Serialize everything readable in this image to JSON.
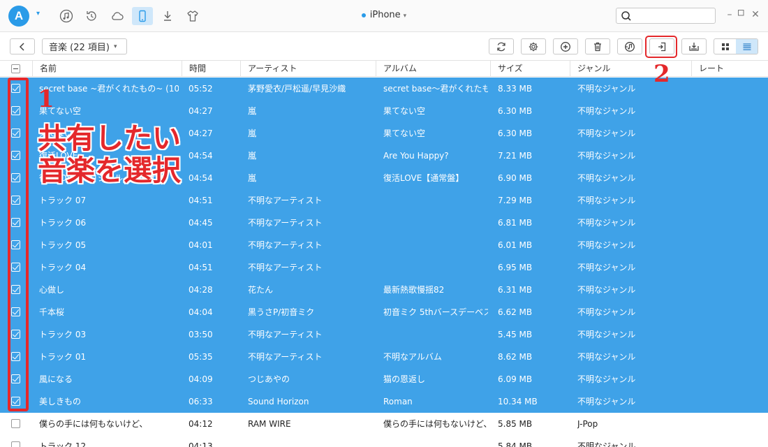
{
  "app": {
    "logo_letter": "A"
  },
  "topnav": {
    "items": [
      {
        "name": "itunes-music-icon",
        "icon": "music"
      },
      {
        "name": "backup-icon",
        "icon": "restore"
      },
      {
        "name": "icloud-icon",
        "icon": "cloud"
      },
      {
        "name": "device-icon",
        "icon": "phone",
        "active": true
      },
      {
        "name": "download-icon",
        "icon": "download"
      },
      {
        "name": "tshirt-icon",
        "icon": "shirt"
      }
    ],
    "device_name": "iPhone",
    "search_placeholder": ""
  },
  "toolbar": {
    "category_label": "音楽 (22 項目)"
  },
  "table": {
    "headers": {
      "name": "名前",
      "time": "時間",
      "artist": "アーティスト",
      "album": "アルバム",
      "size": "サイズ",
      "genre": "ジャンル",
      "rating": "レート"
    },
    "rows": [
      {
        "selected": true,
        "name": "secret base ~君がくれたもの~ (10 yea...",
        "time": "05:52",
        "artist": "茅野愛衣/戸松遥/早見沙織",
        "album": "secret base〜君がくれたも...",
        "size": "8.33 MB",
        "genre": "不明なジャンル"
      },
      {
        "selected": true,
        "name": "果てない空",
        "time": "04:27",
        "artist": "嵐",
        "album": "果てない空",
        "size": "6.30 MB",
        "genre": "不明なジャンル"
      },
      {
        "selected": true,
        "name": "果てない空",
        "time": "04:27",
        "artist": "嵐",
        "album": "果てない空",
        "size": "6.30 MB",
        "genre": "不明なジャンル"
      },
      {
        "selected": true,
        "name": "復活LOVE",
        "time": "04:54",
        "artist": "嵐",
        "album": "Are You Happy?",
        "size": "7.21 MB",
        "genre": "不明なジャンル"
      },
      {
        "selected": true,
        "name": "復活LOVE(オリジナル・カラオケ)",
        "time": "04:54",
        "artist": "嵐",
        "album": "復活LOVE【通常盤】",
        "size": "6.90 MB",
        "genre": "不明なジャンル"
      },
      {
        "selected": true,
        "name": "トラック 07",
        "time": "04:51",
        "artist": "不明なアーティスト",
        "album": "",
        "size": "7.29 MB",
        "genre": "不明なジャンル"
      },
      {
        "selected": true,
        "name": "トラック 06",
        "time": "04:45",
        "artist": "不明なアーティスト",
        "album": "",
        "size": "6.81 MB",
        "genre": "不明なジャンル"
      },
      {
        "selected": true,
        "name": "トラック 05",
        "time": "04:01",
        "artist": "不明なアーティスト",
        "album": "",
        "size": "6.01 MB",
        "genre": "不明なジャンル"
      },
      {
        "selected": true,
        "name": "トラック 04",
        "time": "04:51",
        "artist": "不明なアーティスト",
        "album": "",
        "size": "6.95 MB",
        "genre": "不明なジャンル"
      },
      {
        "selected": true,
        "name": "心做し",
        "time": "04:28",
        "artist": "花たん",
        "album": "最新熱歌慢揺82",
        "size": "6.31 MB",
        "genre": "不明なジャンル"
      },
      {
        "selected": true,
        "name": "千本桜",
        "time": "04:04",
        "artist": "黒うさP/初音ミク",
        "album": "初音ミク 5thバースデーベスト...",
        "size": "6.62 MB",
        "genre": "不明なジャンル"
      },
      {
        "selected": true,
        "name": "トラック 03",
        "time": "03:50",
        "artist": "不明なアーティスト",
        "album": "",
        "size": "5.45 MB",
        "genre": "不明なジャンル"
      },
      {
        "selected": true,
        "name": "トラック 01",
        "time": "05:35",
        "artist": "不明なアーティスト",
        "album": "不明なアルバム",
        "size": "8.62 MB",
        "genre": "不明なジャンル"
      },
      {
        "selected": true,
        "name": "風になる",
        "time": "04:09",
        "artist": "つじあやの",
        "album": "猫の恩返し",
        "size": "6.09 MB",
        "genre": "不明なジャンル"
      },
      {
        "selected": true,
        "name": "美しきもの",
        "time": "06:33",
        "artist": "Sound Horizon",
        "album": "Roman",
        "size": "10.34 MB",
        "genre": "不明なジャンル"
      },
      {
        "selected": false,
        "name": "僕らの手には何もないけど、",
        "time": "04:12",
        "artist": "RAM WIRE",
        "album": "僕らの手には何もないけど、",
        "size": "5.85 MB",
        "genre": "J-Pop"
      },
      {
        "selected": false,
        "name": "トラック 12",
        "time": "04:13",
        "artist": "",
        "album": "",
        "size": "5.84 MB",
        "genre": "不明なジャンル"
      }
    ]
  },
  "annotations": {
    "step1_number": "1",
    "step2_number": "2",
    "step1_text_line1": "共有したい",
    "step1_text_line2": "音楽を選択",
    "color": "#e4282b"
  },
  "colors": {
    "accent": "#2a9be8",
    "selection": "#3fa2e8"
  }
}
